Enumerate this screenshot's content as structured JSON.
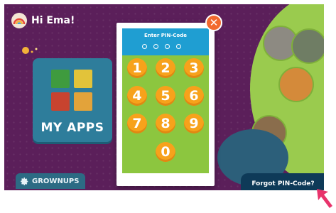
{
  "profile": {
    "greeting": "Hi Ema!"
  },
  "home": {
    "my_apps_label": "MY APPS",
    "grownups_label": "GROWNUPS"
  },
  "pin_dialog": {
    "title": "Enter PIN-Code",
    "pin_slots": 4,
    "keys": [
      "1",
      "2",
      "3",
      "4",
      "5",
      "6",
      "7",
      "8",
      "9",
      "0"
    ],
    "close_icon": "close-icon"
  },
  "forgot_pin_label": "Forgot PIN-Code?",
  "colors": {
    "background": "#5b1f5a",
    "dialog_header": "#1f9ed2",
    "keypad_bg": "#8cc63f",
    "key": "#f7a21b",
    "close": "#f26a2e",
    "forgot_bg": "#0e3a58",
    "pointer_arrow": "#e8336b"
  }
}
